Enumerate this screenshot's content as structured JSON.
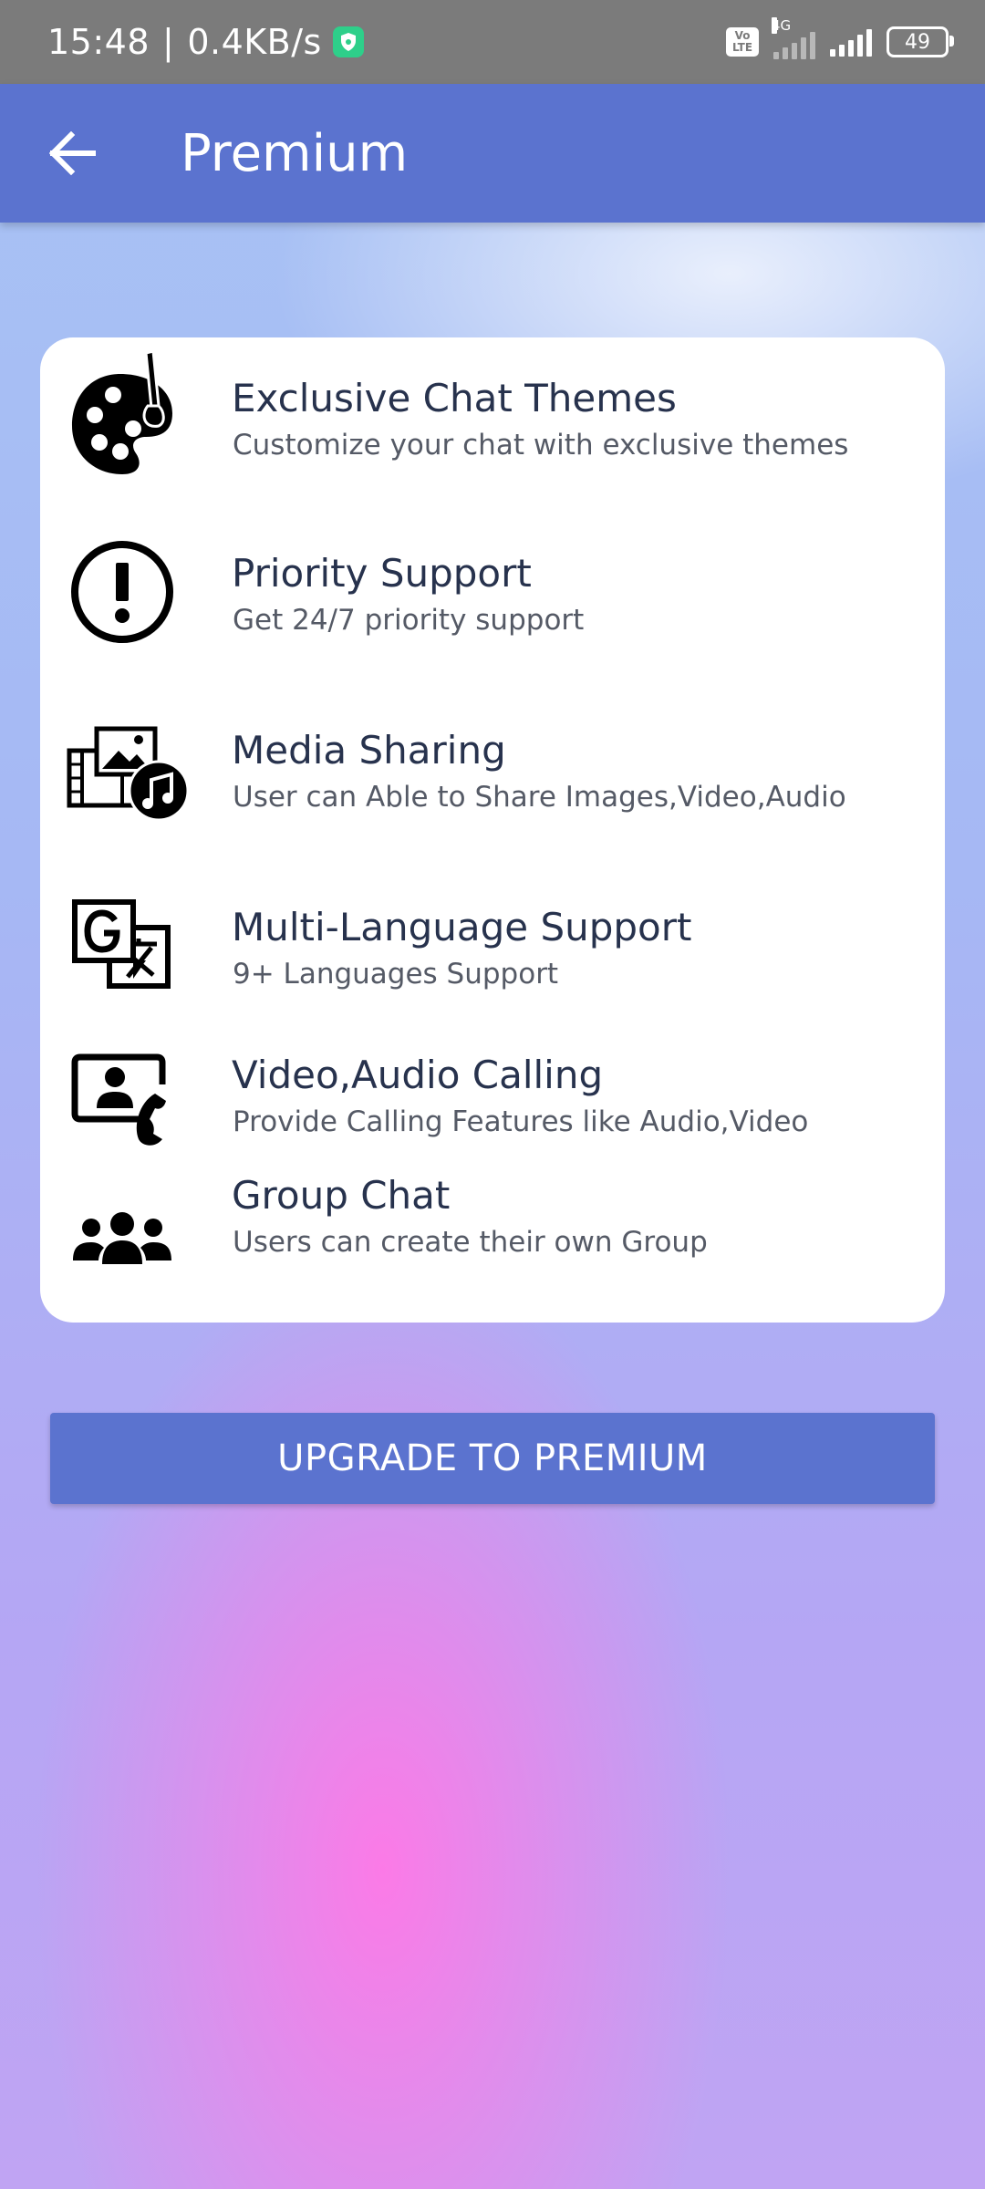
{
  "status_bar": {
    "time": "15:48",
    "separator": "|",
    "speed": "0.4KB/s",
    "volte_top": "Vo",
    "volte_bottom": "LTE",
    "network": "4G",
    "battery": "49"
  },
  "app_bar": {
    "title": "Premium",
    "back_icon": "arrow-left-icon"
  },
  "features": [
    {
      "icon": "palette-icon",
      "title": "Exclusive Chat Themes",
      "description": "Customize your chat with exclusive themes"
    },
    {
      "icon": "exclamation-circle-icon",
      "title": "Priority Support",
      "description": "Get 24/7 priority support"
    },
    {
      "icon": "media-icon",
      "title": "Media Sharing",
      "description": "User can Able to Share Images,Video,Audio"
    },
    {
      "icon": "translate-icon",
      "title": "Multi-Language Support",
      "description": "9+ Languages Support"
    },
    {
      "icon": "video-call-icon",
      "title": "Video,Audio Calling",
      "description": "Provide Calling Features like Audio,Video"
    },
    {
      "icon": "group-icon",
      "title": "Group Chat",
      "description": "Users can create their own Group"
    }
  ],
  "upgrade_button": {
    "label": "UPGRADE TO PREMIUM"
  },
  "colors": {
    "primary": "#5b73cf",
    "status_bar": "#7b7b7b",
    "title_text": "#27324d"
  }
}
